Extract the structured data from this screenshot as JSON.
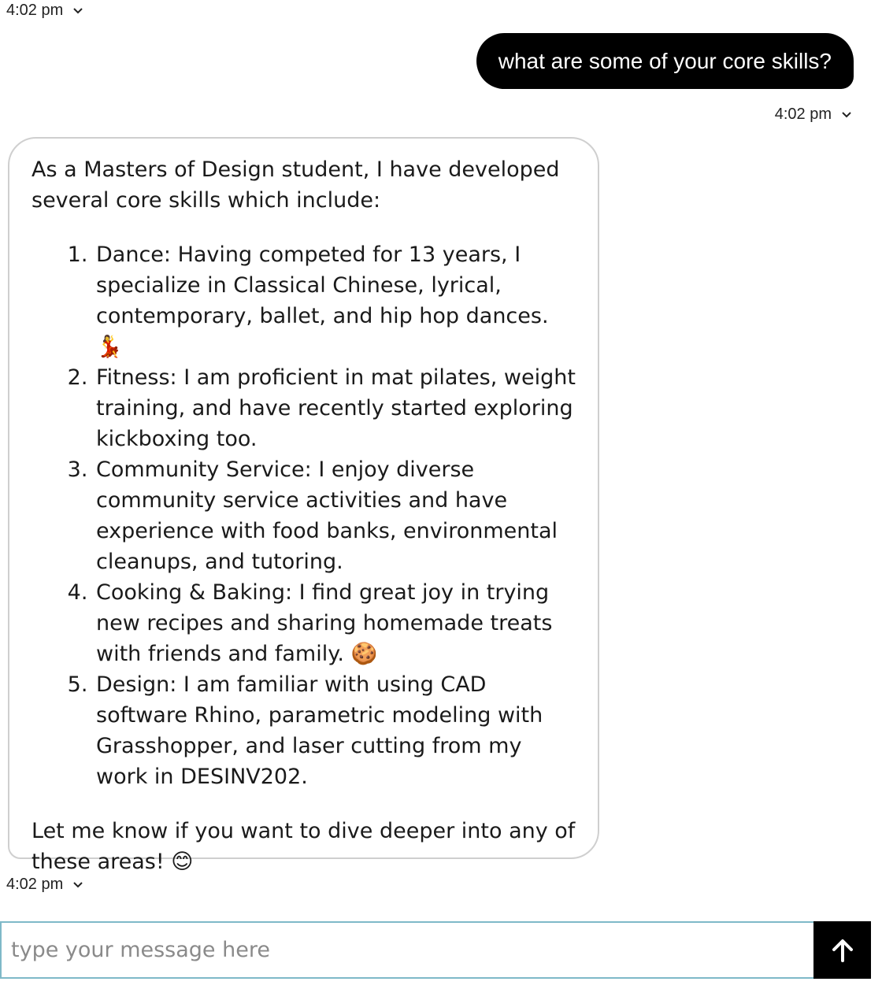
{
  "messages": {
    "first_timestamp": "4:02 pm",
    "user": {
      "text": "what are some of your core skills?",
      "timestamp": "4:02 pm"
    },
    "bot": {
      "intro": "As a Masters of Design student, I have developed several core skills which include:",
      "items": [
        "Dance: Having competed for 13 years, I specialize in Classical Chinese, lyrical, contemporary, ballet, and hip hop dances. 💃",
        "Fitness: I am proficient in mat pilates, weight training, and have recently started exploring kickboxing too.",
        "Community Service: I enjoy diverse community service activities and have experience with food banks, environmental cleanups, and tutoring.",
        "Cooking & Baking: I find great joy in trying new recipes and sharing homemade treats with friends and family. 🍪",
        "Design: I am familiar with using CAD software Rhino, parametric modeling with Grasshopper, and laser cutting from my work in DESINV202."
      ],
      "outro": "Let me know if you want to dive deeper into any of these areas! 😊",
      "timestamp": "4:02 pm"
    }
  },
  "composer": {
    "placeholder": "type your message here",
    "send_icon": "arrow-up-icon"
  }
}
